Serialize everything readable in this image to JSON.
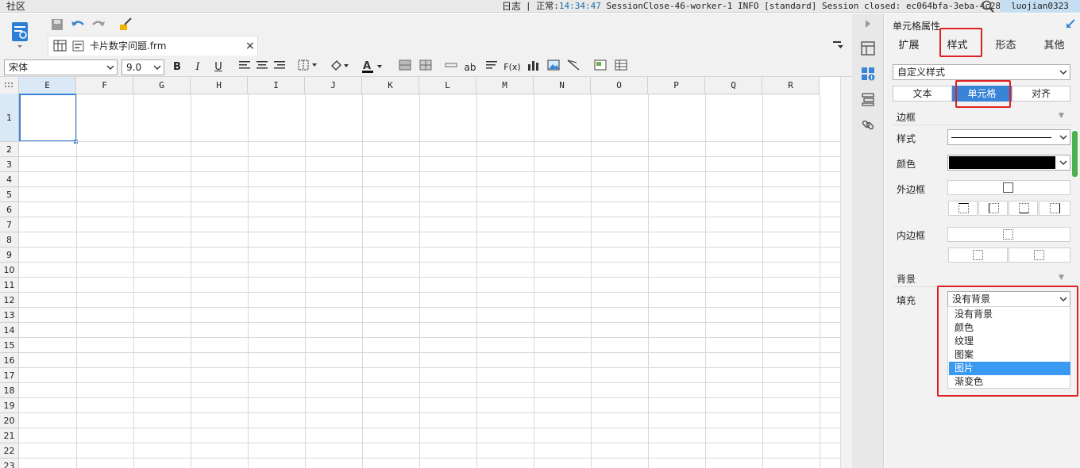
{
  "topbar": {
    "community": "社区",
    "log": "日志",
    "status_prefix": "正常:",
    "status_time": "14:34:47",
    "status_message": "SessionClose-46-worker-1 INFO [standard] Session closed: ec064bfa-3eba-4c28-...",
    "user": "luojian0323"
  },
  "editor": {
    "tab_title": "卡片数字问题.frm",
    "tab_close": "×",
    "font_name": "宋体",
    "font_size": "9.0",
    "bold": "B",
    "italic": "I",
    "underline": "U",
    "text_tool": "ab",
    "formula_tool": "F(x)"
  },
  "sheet": {
    "columns": [
      "E",
      "F",
      "G",
      "H",
      "I",
      "J",
      "K",
      "L",
      "M",
      "N",
      "O",
      "P",
      "Q",
      "R"
    ],
    "rows": [
      "1",
      "2",
      "3",
      "4",
      "5",
      "6",
      "7",
      "8",
      "9",
      "10",
      "11",
      "12",
      "13",
      "14",
      "15",
      "16",
      "17",
      "18",
      "19",
      "20",
      "21",
      "22",
      "23"
    ],
    "selected_cell": "E1"
  },
  "panel": {
    "title": "单元格属性",
    "tabs": [
      "扩展",
      "样式",
      "形态",
      "其他"
    ],
    "active_tab": "样式",
    "style_select": "自定义样式",
    "segments": [
      "文本",
      "单元格",
      "对齐"
    ],
    "active_segment": "单元格",
    "border_section": "边框",
    "border_style_label": "样式",
    "border_color_label": "颜色",
    "outer_border_label": "外边框",
    "inner_border_label": "内边框",
    "background_section": "背景",
    "fill_label": "填充",
    "fill_value": "没有背景",
    "fill_options": [
      "没有背景",
      "颜色",
      "纹理",
      "图案",
      "图片",
      "渐变色"
    ],
    "fill_highlighted": "图片",
    "border_color": "#000000",
    "highlight_color": "#e02020",
    "accent_color": "#3a84d8"
  }
}
